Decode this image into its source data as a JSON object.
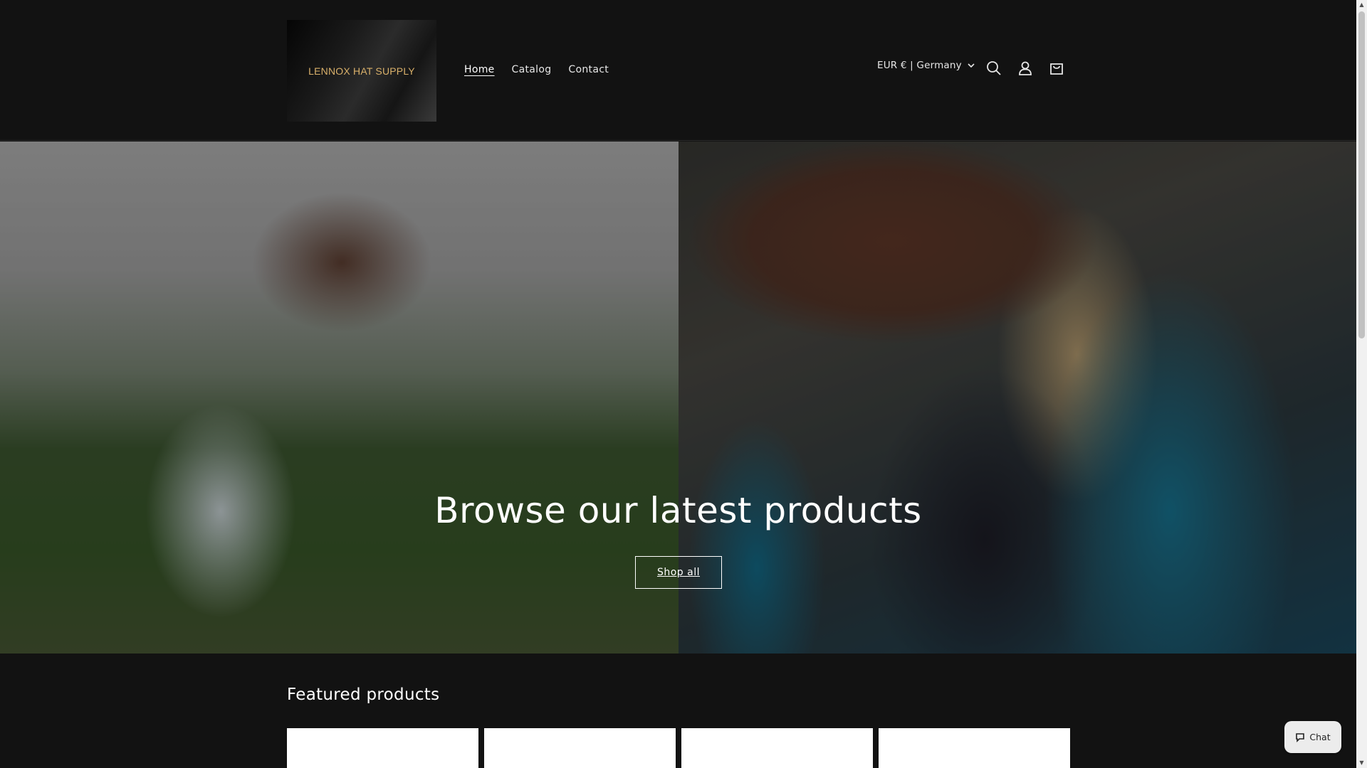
{
  "brand": {
    "logo_text": "LENNOX HAT SUPPLY",
    "logo_text_color": "#d9b06a"
  },
  "nav": {
    "items": [
      {
        "label": "Home",
        "active": true
      },
      {
        "label": "Catalog",
        "active": false
      },
      {
        "label": "Contact",
        "active": false
      }
    ]
  },
  "header": {
    "country_selector": "EUR € | Germany",
    "icons": [
      "search-icon",
      "account-icon",
      "cart-icon"
    ]
  },
  "hero": {
    "title": "Browse our latest products",
    "button_label": "Shop all"
  },
  "featured": {
    "title": "Featured products",
    "product_count_visible": 4
  },
  "chat": {
    "label": "Chat"
  },
  "colors": {
    "background": "#121212",
    "text": "#ffffff",
    "card": "#ffffff"
  }
}
